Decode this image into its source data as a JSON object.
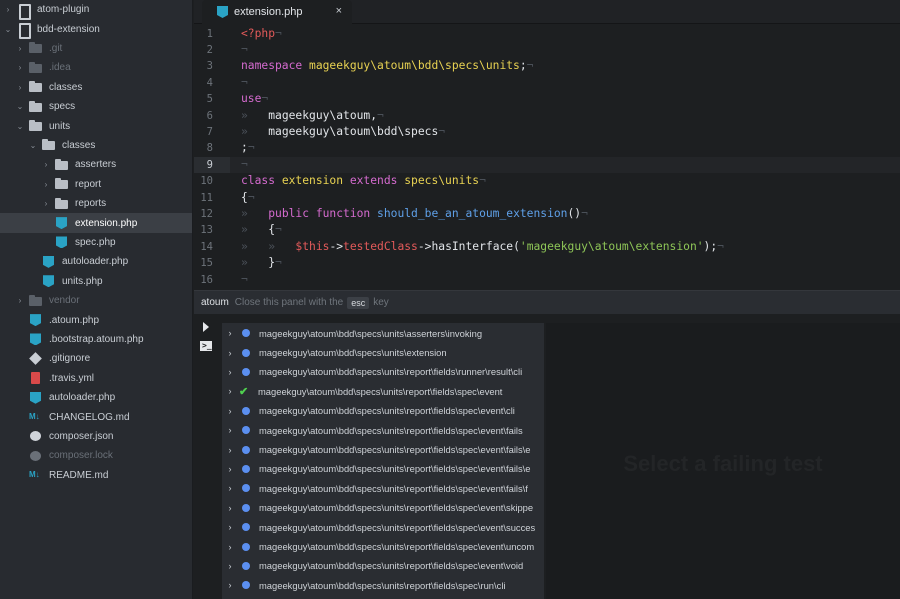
{
  "tree": {
    "items": [
      {
        "label": "atom-plugin",
        "arrow": "›",
        "icon": "repo",
        "level": 0
      },
      {
        "label": "bdd-extension",
        "arrow": "⌄",
        "icon": "repo",
        "level": 0
      },
      {
        "label": ".git",
        "arrow": "›",
        "icon": "folder",
        "level": 1,
        "muted": true
      },
      {
        "label": ".idea",
        "arrow": "›",
        "icon": "folder",
        "level": 1,
        "muted": true
      },
      {
        "label": "classes",
        "arrow": "›",
        "icon": "folder",
        "level": 1
      },
      {
        "label": "specs",
        "arrow": "⌄",
        "icon": "folder",
        "level": 1
      },
      {
        "label": "units",
        "arrow": "⌄",
        "icon": "folder",
        "level": 2
      },
      {
        "label": "classes",
        "arrow": "⌄",
        "icon": "folder",
        "level": 3
      },
      {
        "label": "asserters",
        "arrow": "›",
        "icon": "folder",
        "level": 4
      },
      {
        "label": "report",
        "arrow": "›",
        "icon": "folder",
        "level": 4
      },
      {
        "label": "reports",
        "arrow": "›",
        "icon": "folder",
        "level": 4
      },
      {
        "label": "extension.php",
        "arrow": "",
        "icon": "php",
        "level": 4,
        "selected": true
      },
      {
        "label": "spec.php",
        "arrow": "",
        "icon": "php",
        "level": 4
      },
      {
        "label": "autoloader.php",
        "arrow": "",
        "icon": "php",
        "level": 3
      },
      {
        "label": "units.php",
        "arrow": "",
        "icon": "php",
        "level": 3
      },
      {
        "label": "vendor",
        "arrow": "›",
        "icon": "folder",
        "level": 1,
        "muted": true
      },
      {
        "label": ".atoum.php",
        "arrow": "",
        "icon": "php",
        "level": 2
      },
      {
        "label": ".bootstrap.atoum.php",
        "arrow": "",
        "icon": "php",
        "level": 2
      },
      {
        "label": ".gitignore",
        "arrow": "",
        "icon": "git",
        "level": 2
      },
      {
        "label": ".travis.yml",
        "arrow": "",
        "icon": "yml",
        "level": 2
      },
      {
        "label": "autoloader.php",
        "arrow": "",
        "icon": "php",
        "level": 2
      },
      {
        "label": "CHANGELOG.md",
        "arrow": "",
        "icon": "md",
        "level": 2
      },
      {
        "label": "composer.json",
        "arrow": "",
        "icon": "json",
        "level": 2
      },
      {
        "label": "composer.lock",
        "arrow": "",
        "icon": "json",
        "level": 2,
        "muted": true
      },
      {
        "label": "README.md",
        "arrow": "",
        "icon": "md",
        "level": 2
      }
    ]
  },
  "tab": {
    "label": "extension.php",
    "close": "×"
  },
  "editor": {
    "active_line": 9,
    "lines": [
      [
        [
          "tk-red",
          "<?php"
        ],
        [
          "tk-inv",
          "¬"
        ]
      ],
      [
        [
          "tk-inv",
          "¬"
        ]
      ],
      [
        [
          "tk-kw",
          "namespace "
        ],
        [
          "tk-yel",
          "mageekguy\\atoum\\bdd\\specs\\units"
        ],
        [
          "",
          ";"
        ],
        [
          "tk-inv",
          "¬"
        ]
      ],
      [
        [
          "tk-inv",
          "¬"
        ]
      ],
      [
        [
          "tk-kw",
          "use"
        ],
        [
          "tk-inv",
          "¬"
        ]
      ],
      [
        [
          "tk-inv",
          "»   "
        ],
        [
          "",
          "mageekguy\\atoum,"
        ],
        [
          "tk-inv",
          "¬"
        ]
      ],
      [
        [
          "tk-inv",
          "»   "
        ],
        [
          "",
          "mageekguy\\atoum\\bdd\\specs"
        ],
        [
          "tk-inv",
          "¬"
        ]
      ],
      [
        [
          "",
          ";"
        ],
        [
          "tk-inv",
          "¬"
        ]
      ],
      [
        [
          "tk-inv",
          "¬"
        ]
      ],
      [
        [
          "tk-kw",
          "class "
        ],
        [
          "tk-yel",
          "extension "
        ],
        [
          "tk-kw",
          "extends "
        ],
        [
          "tk-yel",
          "specs\\units"
        ],
        [
          "tk-inv",
          "¬"
        ]
      ],
      [
        [
          "",
          "{"
        ],
        [
          "tk-inv",
          "¬"
        ]
      ],
      [
        [
          "tk-inv",
          "»   "
        ],
        [
          "tk-kw",
          "public function "
        ],
        [
          "tk-fn",
          "should_be_an_atoum_extension"
        ],
        [
          "",
          "()"
        ],
        [
          "tk-inv",
          "¬"
        ]
      ],
      [
        [
          "tk-inv",
          "»   "
        ],
        [
          "",
          "{"
        ],
        [
          "tk-inv",
          "¬"
        ]
      ],
      [
        [
          "tk-inv",
          "»   »   "
        ],
        [
          "tk-red",
          "$this"
        ],
        [
          "",
          "->"
        ],
        [
          "tk-red",
          "testedClass"
        ],
        [
          "",
          "->hasInterface("
        ],
        [
          "tk-str",
          "'mageekguy\\atoum\\extension'"
        ],
        [
          "",
          ");"
        ],
        [
          "tk-inv",
          "¬"
        ]
      ],
      [
        [
          "tk-inv",
          "»   "
        ],
        [
          "",
          "}"
        ],
        [
          "tk-inv",
          "¬"
        ]
      ],
      [
        [
          "tk-inv",
          "¬"
        ]
      ],
      [
        [
          "tk-inv",
          "¬"
        ]
      ]
    ]
  },
  "panel": {
    "title": "atoum",
    "hint_before": "Close this panel with the",
    "key": "esc",
    "hint_after": "key",
    "empty_message": "Select a failing test",
    "tests": [
      {
        "name": "mageekguy\\atoum\\bdd\\specs\\units\\asserters\\invoking",
        "status": "pending"
      },
      {
        "name": "mageekguy\\atoum\\bdd\\specs\\units\\extension",
        "status": "pending"
      },
      {
        "name": "mageekguy\\atoum\\bdd\\specs\\units\\report\\fields\\runner\\result\\cli",
        "status": "pending"
      },
      {
        "name": "mageekguy\\atoum\\bdd\\specs\\units\\report\\fields\\spec\\event",
        "status": "passed"
      },
      {
        "name": "mageekguy\\atoum\\bdd\\specs\\units\\report\\fields\\spec\\event\\cli",
        "status": "pending"
      },
      {
        "name": "mageekguy\\atoum\\bdd\\specs\\units\\report\\fields\\spec\\event\\fails",
        "status": "pending"
      },
      {
        "name": "mageekguy\\atoum\\bdd\\specs\\units\\report\\fields\\spec\\event\\fails\\e",
        "status": "pending"
      },
      {
        "name": "mageekguy\\atoum\\bdd\\specs\\units\\report\\fields\\spec\\event\\fails\\e",
        "status": "pending"
      },
      {
        "name": "mageekguy\\atoum\\bdd\\specs\\units\\report\\fields\\spec\\event\\fails\\f",
        "status": "pending"
      },
      {
        "name": "mageekguy\\atoum\\bdd\\specs\\units\\report\\fields\\spec\\event\\skippe",
        "status": "pending"
      },
      {
        "name": "mageekguy\\atoum\\bdd\\specs\\units\\report\\fields\\spec\\event\\succes",
        "status": "pending"
      },
      {
        "name": "mageekguy\\atoum\\bdd\\specs\\units\\report\\fields\\spec\\event\\uncom",
        "status": "pending"
      },
      {
        "name": "mageekguy\\atoum\\bdd\\specs\\units\\report\\fields\\spec\\event\\void",
        "status": "pending"
      },
      {
        "name": "mageekguy\\atoum\\bdd\\specs\\units\\report\\fields\\spec\\run\\cli",
        "status": "pending"
      }
    ]
  },
  "colors": {
    "pending_dot": "#5b8ff0",
    "passed_check": "#4fd04f",
    "keyword": "#d56bcf",
    "class_name": "#e8d252",
    "variable": "#e35a5a",
    "string": "#8ec557",
    "function": "#5fa0e8"
  }
}
